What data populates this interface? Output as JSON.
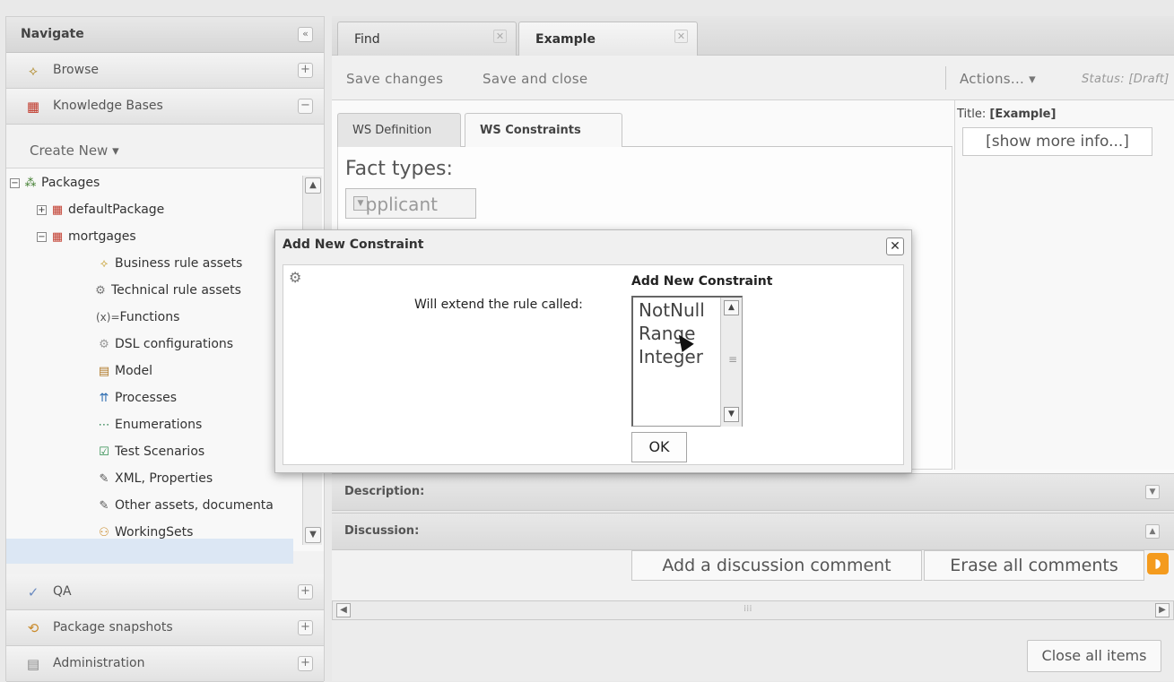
{
  "navigator": {
    "title": "Navigate",
    "collapse_icon": "«",
    "browse": "Browse",
    "knowledge_bases": "Knowledge Bases",
    "create_new": "Create New ▾",
    "tree": {
      "packages": "Packages",
      "default_package": "defaultPackage",
      "mortgages": "mortgages",
      "items": [
        "Business rule assets",
        "Technical rule assets",
        "Functions",
        "DSL configurations",
        "Model",
        "Processes",
        "Enumerations",
        "Test Scenarios",
        "XML, Properties",
        "Other assets, documenta",
        "WorkingSets"
      ],
      "functions_prefix": "(x)="
    },
    "qa": "QA",
    "package_snapshots": "Package snapshots",
    "administration": "Administration"
  },
  "tabs": [
    {
      "label": "Find",
      "close": "✕"
    },
    {
      "label": "Example",
      "close": "✕"
    }
  ],
  "toolbar": {
    "save_changes": "Save changes",
    "save_and_close": "Save and close",
    "actions": "Actions... ▾",
    "status": "Status: [Draft]"
  },
  "editor": {
    "ws_definition_tab": "WS Definition",
    "ws_constraints_tab": "WS Constraints",
    "fact_types_label": "Fact types:",
    "fact_type_selected": "Applicant",
    "title_prefix": "Title: ",
    "title_value": "[Example]",
    "show_more": "[show more info...]"
  },
  "sections": {
    "description": "Description:",
    "discussion": "Discussion:"
  },
  "discussion": {
    "add_comment": "Add a discussion comment",
    "erase_comments": "Erase all comments"
  },
  "close_all": "Close all items",
  "dialog": {
    "title": "Add New Constraint",
    "heading": "Add New Constraint",
    "label": "Will extend the rule called:",
    "options": [
      "NotNull",
      "Range",
      "Integer"
    ],
    "ok": "OK",
    "close": "✕"
  },
  "colors": {
    "selection": "#dce7f4",
    "rss": "#f49b1e"
  }
}
